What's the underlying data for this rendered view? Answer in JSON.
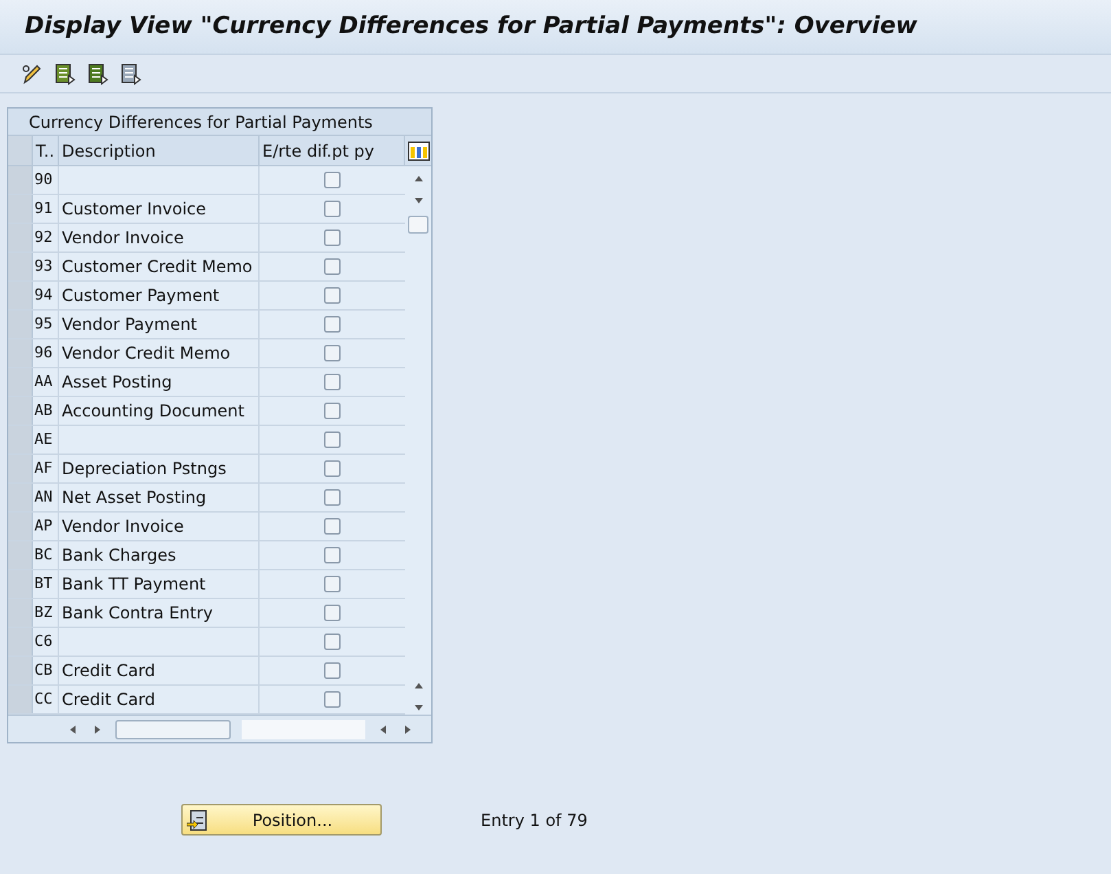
{
  "window": {
    "title": "Display View \"Currency Differences for Partial Payments\": Overview"
  },
  "table": {
    "title": "Currency Differences for Partial Payments",
    "columns": [
      "T..",
      "Description",
      "E/rte dif.pt py"
    ],
    "rows": [
      {
        "code": "90",
        "description": "",
        "checked": false
      },
      {
        "code": "91",
        "description": "Customer Invoice",
        "checked": false
      },
      {
        "code": "92",
        "description": "Vendor Invoice",
        "checked": false
      },
      {
        "code": "93",
        "description": "Customer Credit Memo",
        "checked": false
      },
      {
        "code": "94",
        "description": "Customer Payment",
        "checked": false
      },
      {
        "code": "95",
        "description": "Vendor Payment",
        "checked": false
      },
      {
        "code": "96",
        "description": "Vendor Credit Memo",
        "checked": false
      },
      {
        "code": "AA",
        "description": "Asset Posting",
        "checked": false
      },
      {
        "code": "AB",
        "description": "Accounting Document",
        "checked": false
      },
      {
        "code": "AE",
        "description": "",
        "checked": false
      },
      {
        "code": "AF",
        "description": "Depreciation Pstngs",
        "checked": false
      },
      {
        "code": "AN",
        "description": "Net Asset Posting",
        "checked": false
      },
      {
        "code": "AP",
        "description": "Vendor Invoice",
        "checked": false
      },
      {
        "code": "BC",
        "description": "Bank Charges",
        "checked": false
      },
      {
        "code": "BT",
        "description": "Bank TT Payment",
        "checked": false
      },
      {
        "code": "BZ",
        "description": "Bank Contra Entry",
        "checked": false
      },
      {
        "code": "C6",
        "description": "",
        "checked": false
      },
      {
        "code": "CB",
        "description": "Credit Card",
        "checked": false
      },
      {
        "code": "CC",
        "description": "Credit Card",
        "checked": false
      }
    ]
  },
  "position_button": {
    "label": "Position..."
  },
  "entry_info": "Entry 1 of 79"
}
